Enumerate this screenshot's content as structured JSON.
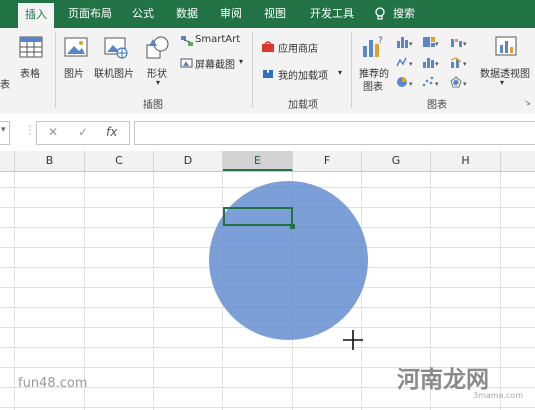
{
  "tabs": {
    "insert": "插入",
    "layout": "页面布局",
    "formulas": "公式",
    "data": "数据",
    "review": "审阅",
    "view": "视图",
    "developer": "开发工具",
    "search": "搜索"
  },
  "ribbon": {
    "tables_cut": "表",
    "table": "表格",
    "picture": "图片",
    "online_picture": "联机图片",
    "shapes": "形状",
    "smartart": "SmartArt",
    "screenshot": "屏幕截图",
    "group_illustrations": "插图",
    "store": "应用商店",
    "my_addins": "我的加载项",
    "group_addins": "加载项",
    "recommended_charts_l1": "推荐的",
    "recommended_charts_l2": "图表",
    "pivot_chart": "数据透视图",
    "group_charts": "图表"
  },
  "formula_bar": {
    "cancel": "✕",
    "enter": "✓",
    "fx": "fx",
    "value": ""
  },
  "columns": [
    "B",
    "C",
    "D",
    "E",
    "F",
    "G",
    "H"
  ],
  "selected_column": "E",
  "watermarks": {
    "left": "fun48.com",
    "brand": "河南龙网",
    "brand_small": "3mama.com"
  },
  "colors": {
    "accent": "#217346",
    "shape_fill": "#6f94d6"
  }
}
